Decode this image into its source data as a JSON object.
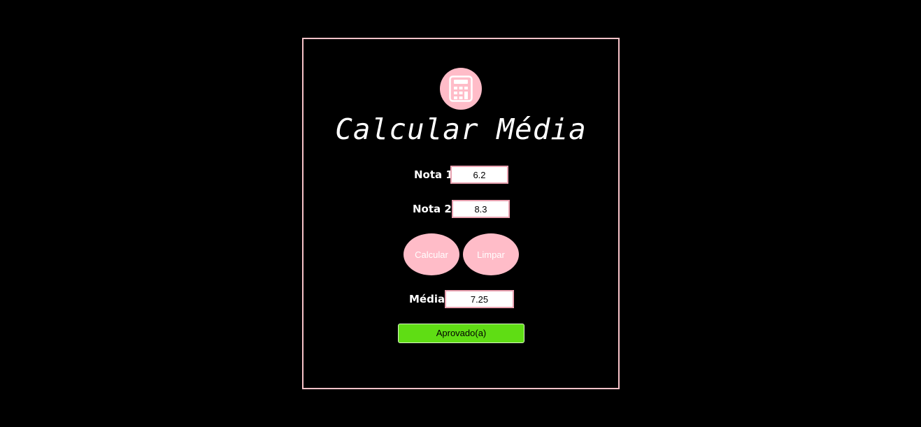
{
  "app": {
    "title": "Calcular Média"
  },
  "icon": {
    "name": "calculator-icon",
    "color": "#ffbcc8"
  },
  "form": {
    "nota1": {
      "label": "Nota 1",
      "value": "6.2"
    },
    "nota2": {
      "label": "Nota 2",
      "value": "8.3"
    },
    "buttons": {
      "calcular": "Calcular",
      "limpar": "Limpar"
    },
    "media": {
      "label": "Média",
      "value": "7.25"
    },
    "status": {
      "text": "Aprovado(a)",
      "color": "#5fdd14"
    }
  },
  "colors": {
    "background": "#000000",
    "accent": "#ffbcc8",
    "border": "#f7c2c8"
  }
}
